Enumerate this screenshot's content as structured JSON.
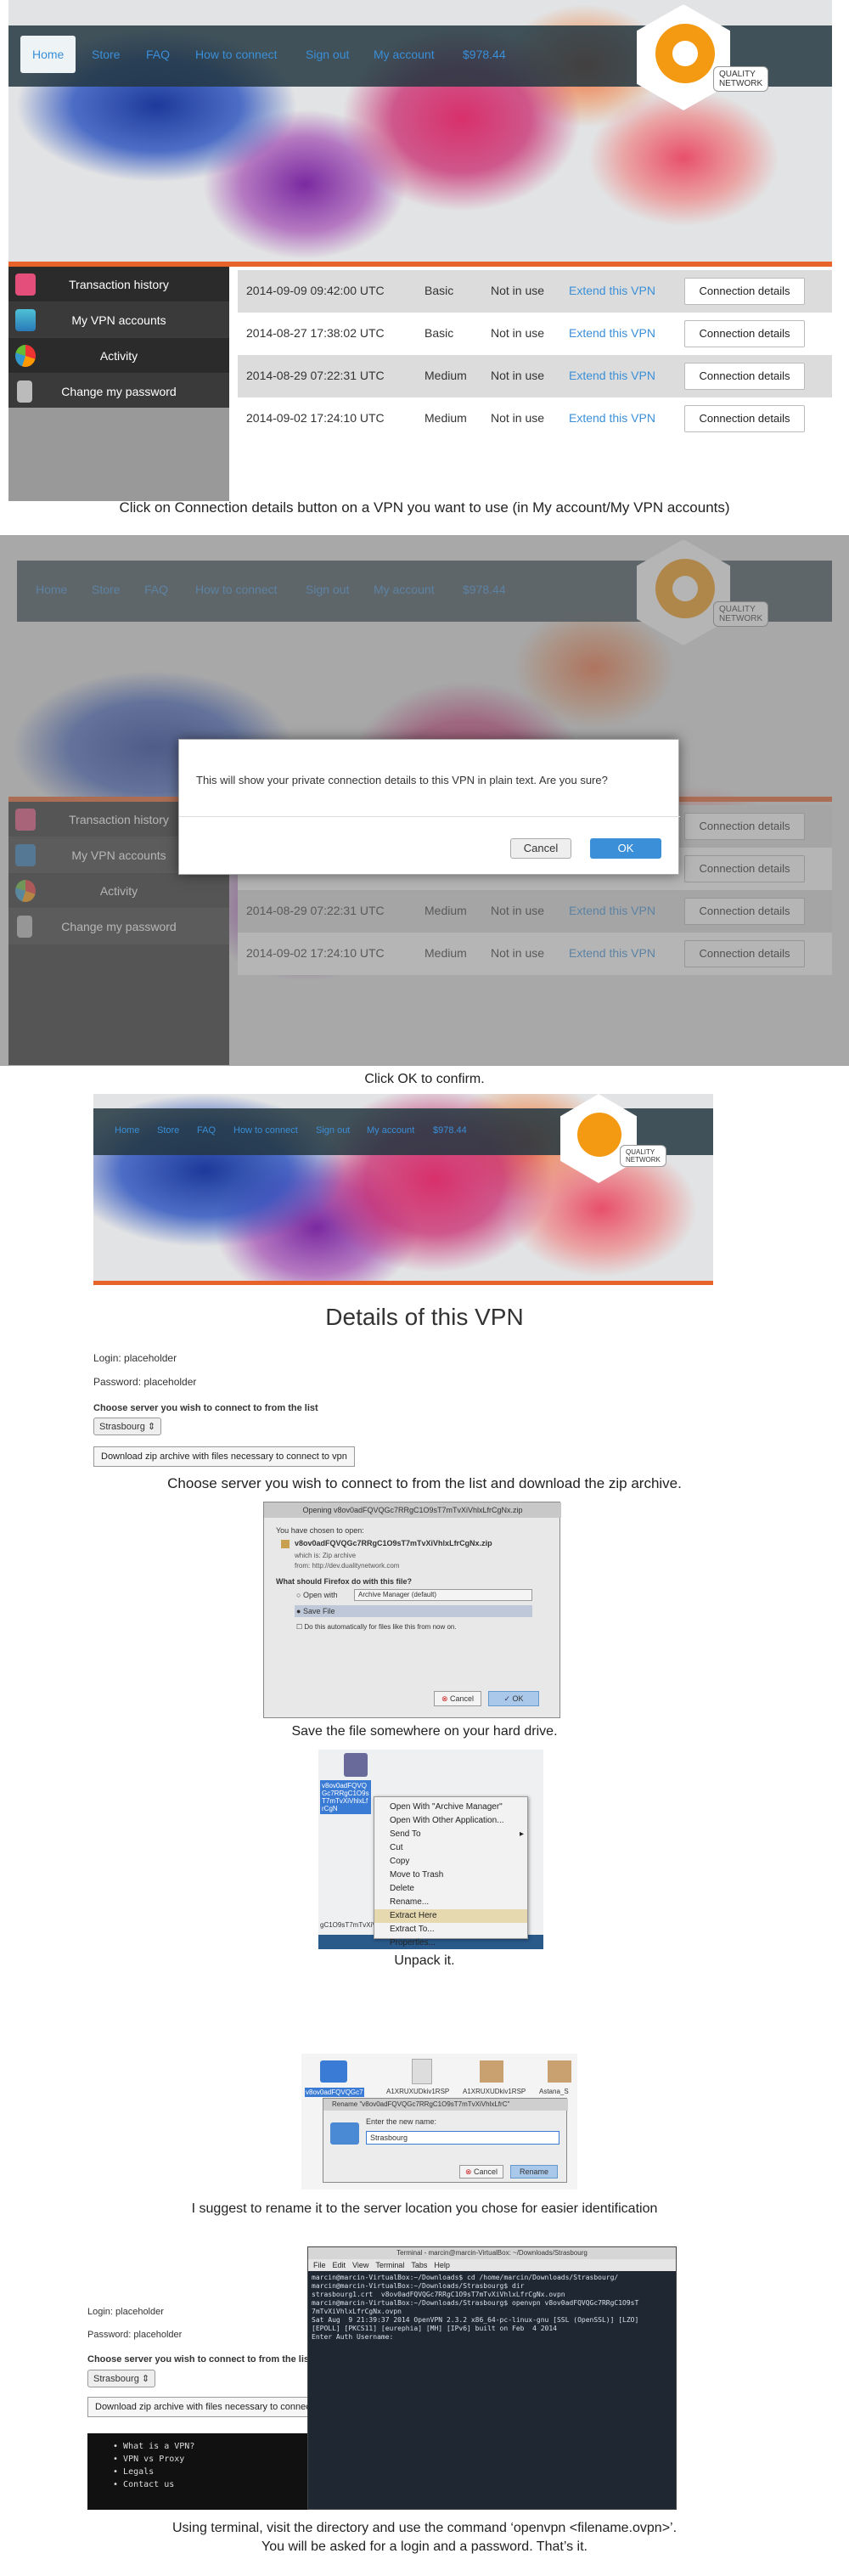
{
  "nav": {
    "home": "Home",
    "store": "Store",
    "faq": "FAQ",
    "how": "How to connect",
    "signout": "Sign out",
    "account": "My account",
    "balance": "$978.44"
  },
  "logo": {
    "line1": "QUALITY",
    "line2": "NETWORK"
  },
  "sidebar": {
    "items": [
      {
        "label": "Transaction history"
      },
      {
        "label": "My VPN accounts"
      },
      {
        "label": "Activity"
      },
      {
        "label": "Change my password"
      }
    ]
  },
  "vpn_rows": [
    {
      "date": "2014-09-09 09:42:00 UTC",
      "plan": "Basic",
      "status": "Not in use",
      "extend": "Extend this VPN",
      "details": "Connection details"
    },
    {
      "date": "2014-08-27 17:38:02 UTC",
      "plan": "Basic",
      "status": "Not in use",
      "extend": "Extend this VPN",
      "details": "Connection details"
    },
    {
      "date": "2014-08-29 07:22:31 UTC",
      "plan": "Medium",
      "status": "Not in use",
      "extend": "Extend this VPN",
      "details": "Connection details"
    },
    {
      "date": "2014-09-02 17:24:10 UTC",
      "plan": "Medium",
      "status": "Not in use",
      "extend": "Extend this VPN",
      "details": "Connection details"
    }
  ],
  "captions": {
    "c1": "Click on Connection details button on a VPN you want to use (in My account/My VPN accounts)",
    "c2": "Click OK to confirm.",
    "c3": "Choose server you wish to connect to from the list and download the zip archive.",
    "c4": "Save the file somewhere on your hard drive.",
    "c5": "Unpack it.",
    "c6": "I suggest to rename it to the server location you chose for easier identification",
    "c7a": "Using terminal, visit the directory and use the command ‘openvpn <filename.ovpn>’.",
    "c7b": "You will be asked for a login and a password. That’s it."
  },
  "confirm": {
    "text": "This will show your private connection details to this VPN in plain text. Are you sure?",
    "cancel": "Cancel",
    "ok": "OK"
  },
  "details": {
    "title": "Details of this VPN",
    "login": "Login: placeholder",
    "password": "Password: placeholder",
    "choose": "Choose server you wish to connect to from the list",
    "server": "Strasbourg",
    "download": "Download zip archive with files necessary to connect to vpn"
  },
  "ff": {
    "title": "Opening v8ov0adFQVQGc7RRgC1O9sT7mTvXiVhlxLfrCgNx.zip",
    "chosen": "You have chosen to open:",
    "filename": "v8ov0adFQVQGc7RRgC1O9sT7mTvXiVhlxLfrCgNx.zip",
    "which": "which is: Zip archive",
    "from": "from: http://dev.dualitynetwork.com",
    "question": "What should Firefox do with this file?",
    "openwith": "Open with",
    "app": "Archive Manager (default)",
    "save": "Save File",
    "auto": "Do this automatically for files like this from now on.",
    "cancel": "Cancel",
    "ok": "OK"
  },
  "unpack": {
    "filelabel": "v8ov0adFQVQGc7RRgC1O9sT7mTvXiVhlxLfrCgN",
    "bottom": "gC1O9sT7mTvXiVhlxLfrCgNx.zip",
    "menu": [
      "Open With \"Archive Manager\"",
      "Open With Other Application...",
      "Send To",
      "Cut",
      "Copy",
      "Move to Trash",
      "Delete",
      "Rename...",
      "Extract Here",
      "Extract To...",
      "Properties..."
    ]
  },
  "rename": {
    "files": [
      "v8ov0adFQVQGc7",
      "A1XRUXUDkiv1RSP",
      "A1XRUXUDkiv1RSP",
      "Astana_S"
    ],
    "title": "Rename \"v8ov0adFQVQGc7RRgC1O9sT7mTvXiVhlxLfrC\"",
    "label": "Enter the new name:",
    "value": "Strasbourg",
    "cancel": "Cancel",
    "rename": "Rename"
  },
  "terminal": {
    "title": "Terminal - marcin@marcin-VirtualBox: ~/Downloads/Strasbourg",
    "menu": [
      "File",
      "Edit",
      "View",
      "Terminal",
      "Tabs",
      "Help"
    ],
    "lines": [
      "marcin@marcin-VirtualBox:~/Downloads$ cd /home/marcin/Downloads/Strasbourg/",
      "marcin@marcin-VirtualBox:~/Downloads/Strasbourg$ dir",
      "strasbourg1.crt  v8ov0adFQVQGc7RRgC1O9sT7mTvXiVhlxLfrCgNx.ovpn",
      "marcin@marcin-VirtualBox:~/Downloads/Strasbourg$ openvpn v8ov0adFQVQGc7RRgC1O9sT",
      "7mTvXiVhlxLfrCgNx.ovpn",
      "Sat Aug  9 21:39:37 2014 OpenVPN 2.3.2 x86_64-pc-linux-gnu [SSL (OpenSSL)] [LZO]",
      "[EPOLL] [PKCS11] [eurephia] [MH] [IPv6] built on Feb  4 2014",
      "Enter Auth Username:"
    ]
  },
  "footer_links": [
    "What is a VPN?",
    "VPN vs Proxy",
    "Legals",
    "Contact us"
  ]
}
